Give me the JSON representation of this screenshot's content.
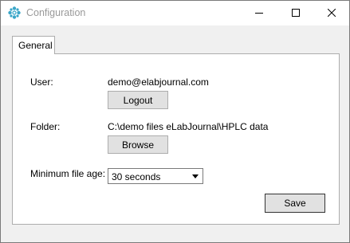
{
  "window": {
    "title": "Configuration",
    "icons": {
      "app": "gear-flower-icon",
      "minimize": "minimize-icon",
      "maximize": "maximize-icon",
      "close": "close-icon"
    }
  },
  "tabs": [
    {
      "label": "General",
      "selected": true
    }
  ],
  "form": {
    "user_label": "User:",
    "user_value": "demo@elabjournal.com",
    "logout_label": "Logout",
    "folder_label": "Folder:",
    "folder_value": "C:\\demo files eLabJournal\\HPLC data",
    "browse_label": "Browse",
    "min_age_label": "Minimum file age:",
    "min_age_value": "30 seconds",
    "save_label": "Save"
  },
  "colors": {
    "accent_icon": "#3aa6c8",
    "title_text": "#999999",
    "button_bg": "#e1e1e1"
  }
}
